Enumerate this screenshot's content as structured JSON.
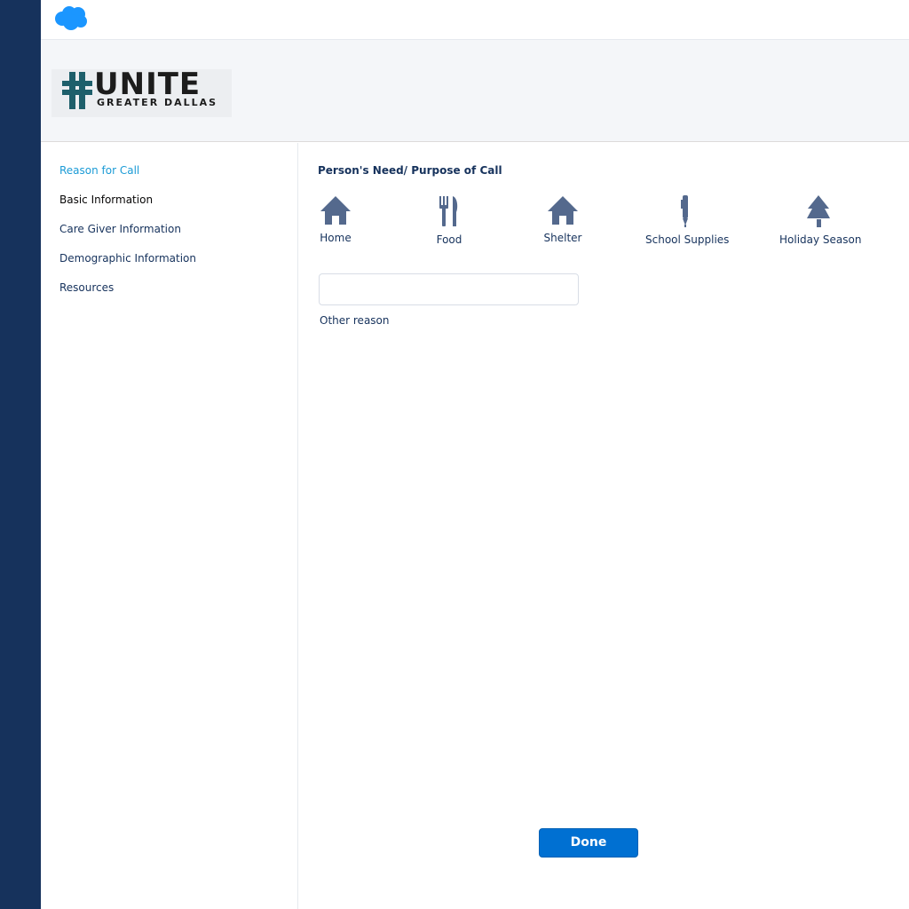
{
  "brand": {
    "icon": "salesforce-cloud-icon",
    "cloud_color": "#1b96ff",
    "logo_text": "UNITE",
    "logo_subtext": "GREATER DALLAS"
  },
  "sidebar": {
    "items": [
      {
        "label": "Reason for Call",
        "state": "active"
      },
      {
        "label": "Basic Information",
        "state": "default"
      },
      {
        "label": "Care Giver Information",
        "state": "default"
      },
      {
        "label": "Demographic Information",
        "state": "default"
      },
      {
        "label": "Resources",
        "state": "default"
      }
    ]
  },
  "main": {
    "section_title": "Person's Need/ Purpose of Call",
    "options": [
      {
        "label": "Home",
        "icon": "house-icon"
      },
      {
        "label": "Food",
        "icon": "fork-knife-icon"
      },
      {
        "label": "Shelter",
        "icon": "house-icon"
      },
      {
        "label": "School Supplies",
        "icon": "pen-icon"
      },
      {
        "label": "Holiday Season",
        "icon": "tree-icon"
      }
    ],
    "other_input_value": "",
    "other_label": "Other reason",
    "done_label": "Done"
  },
  "colors": {
    "rail": "#16325c",
    "accent": "#1b9bd6",
    "icon": "#54698d",
    "button": "#0070d2"
  }
}
